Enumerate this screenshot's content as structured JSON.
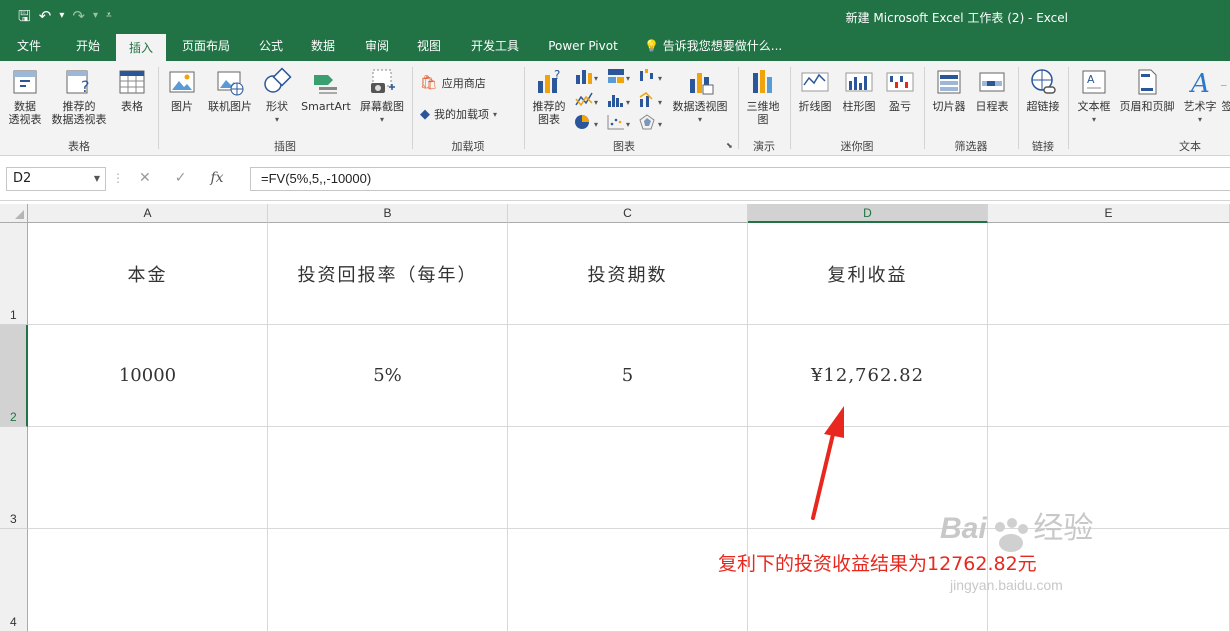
{
  "window": {
    "title": "新建 Microsoft Excel 工作表 (2) - Excel"
  },
  "tabs": [
    "文件",
    "开始",
    "插入",
    "页面布局",
    "公式",
    "数据",
    "审阅",
    "视图",
    "开发工具",
    "Power Pivot"
  ],
  "active_tab": "插入",
  "tell_me": "告诉我您想要做什么...",
  "ribbon": {
    "pivot_table": "数据\n透视表",
    "recommended_pivot": "推荐的\n数据透视表",
    "table": "表格",
    "group_tables": "表格",
    "pictures": "图片",
    "online_pictures": "联机图片",
    "shapes": "形状",
    "smartart": "SmartArt",
    "screenshot": "屏幕截图",
    "group_illustrations": "插图",
    "store": "应用商店",
    "my_addins": "我的加载项",
    "group_addins": "加载项",
    "recommended_charts": "推荐的\n图表",
    "pivot_chart": "数据透视图",
    "group_charts": "图表",
    "map_3d": "三维地\n图",
    "group_tours": "演示",
    "line_sparkline": "折线图",
    "column_sparkline": "柱形图",
    "winloss_sparkline": "盈亏",
    "group_sparklines": "迷你图",
    "slicer": "切片器",
    "timeline": "日程表",
    "group_filters": "筛选器",
    "hyperlink": "超链接",
    "group_links": "链接",
    "textbox": "文本框",
    "header_footer": "页眉和页脚",
    "wordart": "艺术字",
    "signature": "签",
    "group_text": "文本"
  },
  "formula_bar": {
    "name_box": "D2",
    "cancel": "✕",
    "enter": "✓",
    "fx": "fx",
    "formula": "=FV(5%,5,,-10000)"
  },
  "sheet": {
    "columns": [
      "A",
      "B",
      "C",
      "D",
      "E"
    ],
    "selected_column": "D",
    "rows": [
      "1",
      "2",
      "3",
      "4"
    ],
    "selected_row": "2",
    "cells": {
      "A1": "本金",
      "B1": "投资回报率（每年）",
      "C1": "投资期数",
      "D1": "复利收益",
      "A2": "10000",
      "B2": "5%",
      "C2": "5",
      "D2": "¥12,762.82"
    }
  },
  "annotation": "复利下的投资收益结果为12762.82元",
  "watermark": {
    "brand": "Bai",
    "brand2": "经验",
    "url": "jingyan.baidu.com"
  },
  "colors": {
    "excel_green": "#217346",
    "annotation_red": "#e8281e"
  }
}
